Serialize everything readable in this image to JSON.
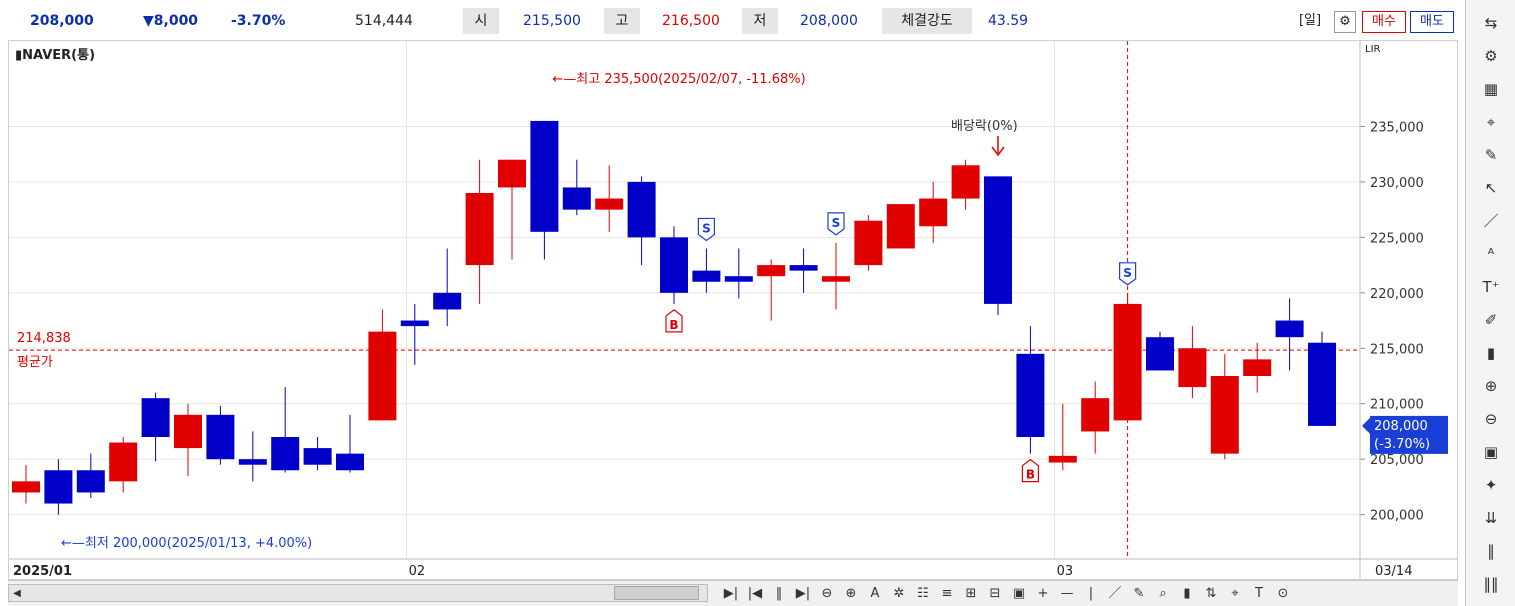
{
  "quote": {
    "price": "208,000",
    "change": "▼8,000",
    "change_pct": "-3.70%",
    "volume": "514,444",
    "open_label": "시",
    "open": "215,500",
    "high_label": "고",
    "high": "216,500",
    "low_label": "저",
    "low": "208,000",
    "strength_label": "체결강도",
    "strength": "43.59"
  },
  "toolbar": {
    "period": "[일]",
    "buy": "매수",
    "sell": "매도",
    "lir": "LIR"
  },
  "colors": {
    "up": "#e00000",
    "down": "#0000c8",
    "avg_line": "#e00000",
    "grid": "#e6e6e6",
    "price_box": "#1a3fd6"
  },
  "chart_data": {
    "type": "candlestick",
    "title": "NAVER(통)",
    "xlabel": "",
    "ylabel": "",
    "ylim": [
      196000,
      240000
    ],
    "yticks": [
      200000,
      205000,
      210000,
      215000,
      220000,
      225000,
      230000,
      235000
    ],
    "ytick_labels": [
      "200,000",
      "205,000",
      "210,000",
      "215,000",
      "220,000",
      "225,000",
      "230,000",
      "235,000"
    ],
    "grid": true,
    "x_axis_labels": [
      {
        "index": 0,
        "label": "2025/01"
      },
      {
        "index": 12,
        "label": "02"
      },
      {
        "index": 32,
        "label": "03"
      },
      {
        "index": 42,
        "label": "03/14"
      }
    ],
    "candles": [
      {
        "o": 202000,
        "h": 204500,
        "l": 201000,
        "c": 203000
      },
      {
        "o": 204000,
        "h": 205000,
        "l": 200000,
        "c": 201000
      },
      {
        "o": 204000,
        "h": 205500,
        "l": 201500,
        "c": 202000
      },
      {
        "o": 203000,
        "h": 207000,
        "l": 202000,
        "c": 206500
      },
      {
        "o": 210500,
        "h": 211000,
        "l": 204800,
        "c": 207000
      },
      {
        "o": 206000,
        "h": 210000,
        "l": 203500,
        "c": 209000
      },
      {
        "o": 209000,
        "h": 209800,
        "l": 204500,
        "c": 205000
      },
      {
        "o": 205000,
        "h": 207500,
        "l": 203000,
        "c": 204500
      },
      {
        "o": 207000,
        "h": 211500,
        "l": 203800,
        "c": 204000
      },
      {
        "o": 206000,
        "h": 207000,
        "l": 204000,
        "c": 204500
      },
      {
        "o": 205500,
        "h": 209000,
        "l": 203800,
        "c": 204000
      },
      {
        "o": 208500,
        "h": 218500,
        "l": 208500,
        "c": 216500
      },
      {
        "o": 217500,
        "h": 219000,
        "l": 213500,
        "c": 217000
      },
      {
        "o": 220000,
        "h": 224000,
        "l": 217000,
        "c": 218500
      },
      {
        "o": 222500,
        "h": 232000,
        "l": 219000,
        "c": 229000
      },
      {
        "o": 229500,
        "h": 232000,
        "l": 223000,
        "c": 232000
      },
      {
        "o": 235500,
        "h": 235500,
        "l": 223000,
        "c": 225500
      },
      {
        "o": 229500,
        "h": 232000,
        "l": 227000,
        "c": 227500
      },
      {
        "o": 227500,
        "h": 231500,
        "l": 225500,
        "c": 228500
      },
      {
        "o": 230000,
        "h": 230500,
        "l": 222500,
        "c": 225000
      },
      {
        "o": 225000,
        "h": 226000,
        "l": 219000,
        "c": 220000
      },
      {
        "o": 222000,
        "h": 224000,
        "l": 220000,
        "c": 221000
      },
      {
        "o": 221500,
        "h": 224000,
        "l": 219500,
        "c": 221000
      },
      {
        "o": 221500,
        "h": 223000,
        "l": 217500,
        "c": 222500
      },
      {
        "o": 222500,
        "h": 224000,
        "l": 220000,
        "c": 222000
      },
      {
        "o": 221000,
        "h": 224500,
        "l": 218500,
        "c": 221500
      },
      {
        "o": 222500,
        "h": 227000,
        "l": 222000,
        "c": 226500
      },
      {
        "o": 224000,
        "h": 228000,
        "l": 224000,
        "c": 228000
      },
      {
        "o": 226000,
        "h": 230000,
        "l": 224500,
        "c": 228500
      },
      {
        "o": 228500,
        "h": 232000,
        "l": 227500,
        "c": 231500
      },
      {
        "o": 230500,
        "h": 230500,
        "l": 218000,
        "c": 219000
      },
      {
        "o": 214500,
        "h": 217000,
        "l": 205500,
        "c": 207000
      },
      {
        "o": 204700,
        "h": 210000,
        "l": 204000,
        "c": 205300
      },
      {
        "o": 207500,
        "h": 212000,
        "l": 205500,
        "c": 210500
      },
      {
        "o": 208500,
        "h": 220000,
        "l": 208500,
        "c": 219000
      },
      {
        "o": 216000,
        "h": 216500,
        "l": 213000,
        "c": 213000
      },
      {
        "o": 211500,
        "h": 217000,
        "l": 210500,
        "c": 215000
      },
      {
        "o": 205500,
        "h": 214500,
        "l": 205000,
        "c": 212500
      },
      {
        "o": 212500,
        "h": 215500,
        "l": 211000,
        "c": 214000
      },
      {
        "o": 217500,
        "h": 219500,
        "l": 213000,
        "c": 216000
      },
      {
        "o": 215500,
        "h": 216500,
        "l": 208000,
        "c": 208000
      }
    ],
    "average_price": {
      "value": 214838,
      "label": "214,838",
      "name": "평균가"
    },
    "high_annotation": "←—최고 235,500(2025/02/07, -11.68%)",
    "low_annotation": "←—최저 200,000(2025/01/13, +4.00%)",
    "dividend_annotation": "배당락(0%)",
    "current_price": {
      "value": 208000,
      "label": "208,000",
      "pct": "(-3.70%)"
    },
    "markers": [
      {
        "index": 20,
        "type": "B",
        "side": "below"
      },
      {
        "index": 21,
        "type": "S",
        "side": "above"
      },
      {
        "index": 25,
        "type": "S",
        "side": "above"
      },
      {
        "index": 31,
        "type": "B",
        "side": "below"
      },
      {
        "index": 34,
        "type": "S",
        "side": "above"
      }
    ]
  },
  "right_toolbar": [
    "refresh-icon",
    "gear-icon",
    "chart-icon",
    "cross-icon",
    "pen-icon",
    "cursor-icon",
    "line-icon",
    "auto-icon",
    "text-icon",
    "label-icon",
    "candle-icon",
    "zoom-in-icon",
    "zoom-out-icon",
    "fit-icon",
    "pattern-icon",
    "ruler-icon",
    "bars-icon",
    "bars2-icon"
  ],
  "bottom": {
    "tools": [
      "▶|",
      "|◀",
      "‖",
      "▶|",
      "⊖",
      "⊕",
      "A",
      "✲",
      "☷",
      "≡",
      "⊞",
      "⊟",
      "▣",
      "+",
      "—",
      "|",
      "／",
      "✎",
      "⌕",
      "▮",
      "⇅",
      "⌖",
      "T",
      "⊙"
    ]
  }
}
